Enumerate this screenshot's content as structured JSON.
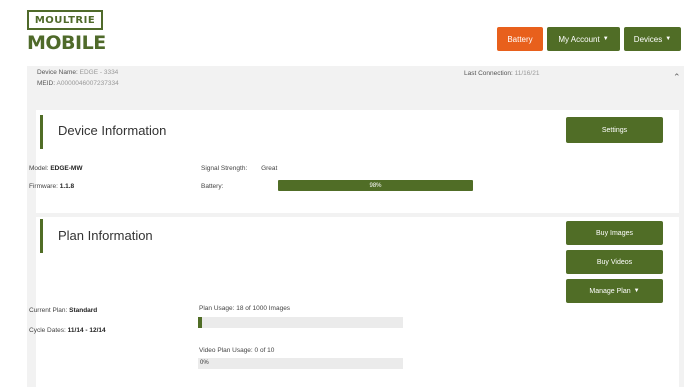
{
  "logo": {
    "top": "MOULTRIE",
    "bottom": "MOBILE"
  },
  "nav": {
    "battery": "Battery",
    "account": "My Account",
    "devices": "Devices"
  },
  "device": {
    "name_label": "Device Name:",
    "name_value": "EDGE - 3334",
    "meid_label": "MEID:",
    "meid_value": "A0000046007237334",
    "last_conn_label": "Last Connection:",
    "last_conn_value": "11/16/21"
  },
  "info": {
    "title": "Device Information",
    "settings": "Settings",
    "model_label": "Model:",
    "model_value": "EDGE-MW",
    "firmware_label": "Firmware:",
    "firmware_value": "1.1.8",
    "signal_label": "Signal Strength:",
    "signal_value": "Great",
    "battery_label": "Battery:",
    "battery_value": "98%",
    "battery_level": 1.0
  },
  "plan": {
    "title": "Plan Information",
    "buy_images": "Buy Images",
    "buy_videos": "Buy Videos",
    "manage_plan": "Manage Plan",
    "current_label": "Current Plan:",
    "current_value": "Standard",
    "cycle_label": "Cycle Dates:",
    "cycle_value": "11/14 - 12/14",
    "usage_label": "Plan Usage: 18 of 1000 Images",
    "usage_level": 0.018,
    "video_label": "Video Plan Usage: 0 of 10",
    "video_text": "0%",
    "video_level": 0
  },
  "colors": {
    "primary": "#506d26",
    "accent": "#e8601c"
  }
}
